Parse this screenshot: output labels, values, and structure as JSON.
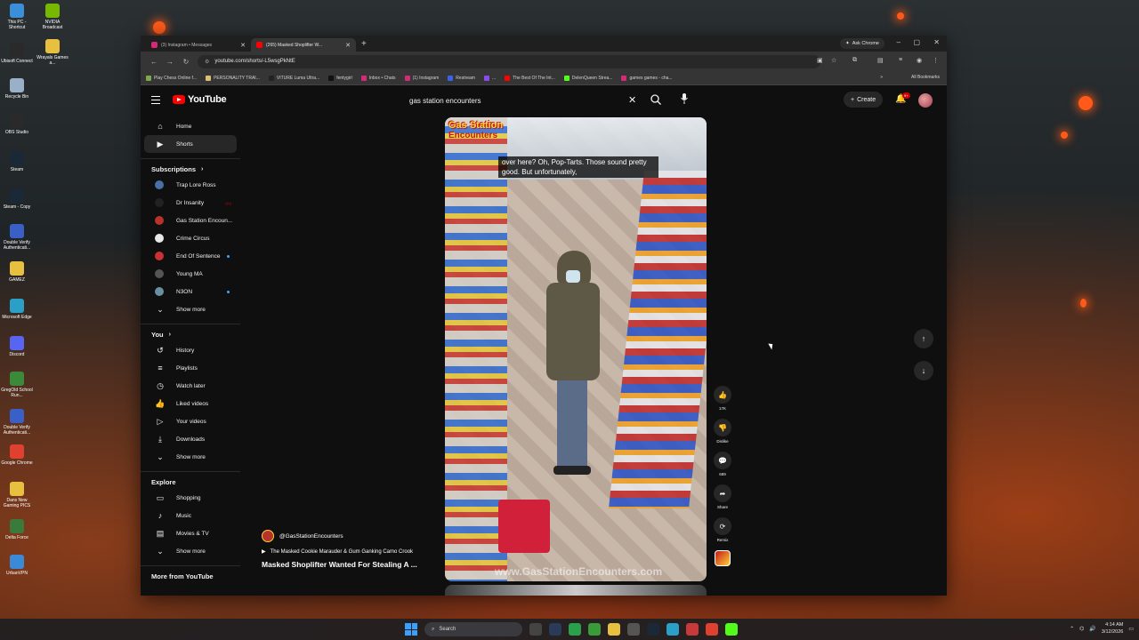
{
  "browser": {
    "tabs": [
      {
        "title": "(3) Instagram • Messages",
        "active": false,
        "favicon_color": "#d62976"
      },
      {
        "title": "(265) Masked Shoplifter W...",
        "active": true,
        "favicon_color": "#ff0000"
      }
    ],
    "ask_chrome": "Ask Chrome",
    "url": "youtube.com/shorts/-L5wsgPkNtE",
    "bookmarks": [
      {
        "label": "Play Chess Online f...",
        "color": "#7fa650"
      },
      {
        "label": "PERSONALITY TRAI...",
        "color": "#e0c070"
      },
      {
        "label": "VITURE Luma Ultra...",
        "color": "#222222"
      },
      {
        "label": "fentygirl",
        "color": "#111111"
      },
      {
        "label": "Inbox • Chats",
        "color": "#d62976"
      },
      {
        "label": "(1) Instagram",
        "color": "#d62976"
      },
      {
        "label": "Restream",
        "color": "#3a60f0"
      },
      {
        "label": "...",
        "color": "#8a4af0"
      },
      {
        "label": "The Best Of The Int...",
        "color": "#ff0000"
      },
      {
        "label": "DelenQueen Strea...",
        "color": "#53fc18"
      },
      {
        "label": "games games - cha...",
        "color": "#d62976"
      }
    ],
    "all_bookmarks": "All Bookmarks"
  },
  "youtube": {
    "logo_text": "YouTube",
    "search_value": "gas station encounters",
    "create_label": "Create",
    "notif_count": "9+",
    "nav": [
      {
        "label": "Home",
        "icon": "⌂"
      },
      {
        "label": "Shorts",
        "icon": "▶"
      }
    ],
    "subscriptions_heading": "Subscriptions",
    "subscriptions": [
      {
        "label": "Trap Lore Ross",
        "color": "#4a6fa5",
        "indicator": ""
      },
      {
        "label": "Dr Insanity",
        "color": "#222222",
        "indicator": "red"
      },
      {
        "label": "Gas Station Encoun...",
        "color": "#b6322a",
        "indicator": ""
      },
      {
        "label": "Crime Circus",
        "color": "#e8e8e8",
        "indicator": ""
      },
      {
        "label": "End Of Sentence",
        "color": "#c83232",
        "indicator": "dot"
      },
      {
        "label": "Young MA",
        "color": "#555555",
        "indicator": ""
      },
      {
        "label": "N3ON",
        "color": "#6a8fa0",
        "indicator": "dot"
      }
    ],
    "show_more": "Show more",
    "you_heading": "You",
    "you_items": [
      {
        "label": "History",
        "icon": "↺"
      },
      {
        "label": "Playlists",
        "icon": "≡"
      },
      {
        "label": "Watch later",
        "icon": "◷"
      },
      {
        "label": "Liked videos",
        "icon": "👍"
      },
      {
        "label": "Your videos",
        "icon": "▷"
      },
      {
        "label": "Downloads",
        "icon": "⤓"
      }
    ],
    "explore_heading": "Explore",
    "explore_items": [
      {
        "label": "Shopping",
        "icon": "▭"
      },
      {
        "label": "Music",
        "icon": "♪"
      },
      {
        "label": "Movies & TV",
        "icon": "▤"
      }
    ],
    "more_heading": "More from YouTube",
    "short": {
      "channel_logo_line1": "Gas Station",
      "channel_logo_line2": "Encounters",
      "caption": "over here? Oh, Pop-Tarts. Those sound pretty good. But unfortunately,",
      "watermark": "www.GasStationEncounters.com",
      "channel": "@GasStationEncounters",
      "playlist": "The Masked Cookie Marauder & Gum Ganking Camo Crook",
      "title": "Masked Shoplifter Wanted For Stealing A ..."
    },
    "actions": [
      {
        "name": "like",
        "icon": "👍",
        "label": "17K"
      },
      {
        "name": "dislike",
        "icon": "👎",
        "label": "Dislike"
      },
      {
        "name": "comments",
        "icon": "💬",
        "label": "689"
      },
      {
        "name": "share",
        "icon": "➦",
        "label": "Share"
      },
      {
        "name": "remix",
        "icon": "⟳",
        "label": "Remix"
      }
    ]
  },
  "desktop_icons": [
    {
      "label": "This PC - Shortcut",
      "color": "#3a8fd8"
    },
    {
      "label": "NVIDIA Broadcast",
      "color": "#76b900"
    },
    {
      "label": "Ubisoft Connect",
      "color": "#2a2a2a"
    },
    {
      "label": "Wrayals Games a...",
      "color": "#e8c040"
    },
    {
      "label": "Recycle Bin",
      "color": "#9ab0c8"
    },
    {
      "label": "OBS Studio",
      "color": "#2a2a2a"
    },
    {
      "label": "Steam",
      "color": "#1b2838"
    },
    {
      "label": "Steam - Copy",
      "color": "#1b2838"
    },
    {
      "label": "Double Verify Authenticati...",
      "color": "#3a60c8"
    },
    {
      "label": "GAMEZ",
      "color": "#e8c040"
    },
    {
      "label": "Microsoft Edge",
      "color": "#2aa0c8"
    },
    {
      "label": "Discord",
      "color": "#5865f2"
    },
    {
      "label": "GregOld School Run...",
      "color": "#3a8a3a"
    },
    {
      "label": "Double Verify Authenticati...",
      "color": "#3a60c8"
    },
    {
      "label": "Google Chrome",
      "color": "#e04030"
    },
    {
      "label": "Dans New Gaming PICS",
      "color": "#e8c040"
    },
    {
      "label": "Delta Force",
      "color": "#3a7a3a"
    },
    {
      "label": "UrbanVPN",
      "color": "#3a8ad8"
    }
  ],
  "taskbar": {
    "search_placeholder": "Search",
    "time": "4:14 AM",
    "date": "3/12/2026"
  }
}
